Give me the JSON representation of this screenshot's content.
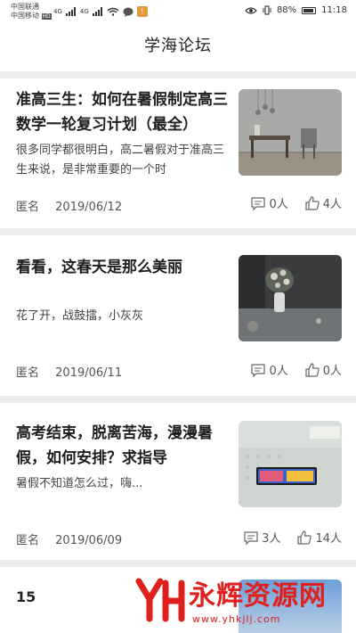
{
  "status_bar": {
    "carrier_1": "中国联通",
    "carrier_2": "中国移动",
    "hd_badge": "HD",
    "network": "4G",
    "battery_text": "88%",
    "battery_level": 0.88,
    "time": "11:18"
  },
  "header": {
    "title": "学海论坛"
  },
  "posts": [
    {
      "title": "准高三生：如何在暑假制定高三数学一轮复习计划（最全）",
      "excerpt": "很多同学都很明白，高二暑假对于准高三生来说，是非常重要的一个时",
      "author": "匿名",
      "date": "2019/06/12",
      "comments": "0人",
      "likes": "4人"
    },
    {
      "title": "看看，这春天是那么美丽",
      "excerpt": "花了开，战鼓擂，小灰灰",
      "author": "匿名",
      "date": "2019/06/11",
      "comments": "0人",
      "likes": "0人"
    },
    {
      "title": "高考结束，脱离苦海，漫漫暑假，如何安排？求指导",
      "excerpt": "暑假不知道怎么过，嗨...",
      "author": "匿名",
      "date": "2019/06/09",
      "comments": "3人",
      "likes": "14人"
    }
  ],
  "footer": {
    "page_indicator": "15"
  },
  "watermark": {
    "text": "永辉资源网",
    "url": "www.yhkjlj.com"
  },
  "colors": {
    "accent": "#e0201f",
    "background": "#ececec",
    "card": "#ffffff",
    "notify": "#e59a3a"
  }
}
